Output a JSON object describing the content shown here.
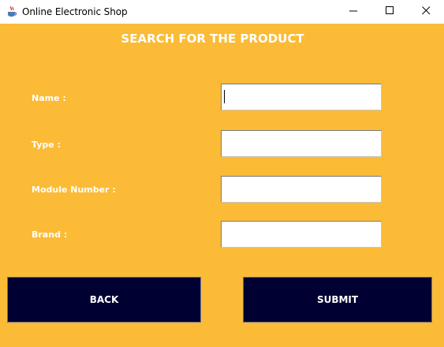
{
  "window": {
    "title": "Online Electronic Shop",
    "icons": {
      "app": "java-cup-icon",
      "minimize": "minimize-icon",
      "maximize": "maximize-icon",
      "close": "close-icon"
    }
  },
  "form": {
    "heading": "SEARCH FOR THE PRODUCT",
    "fields": [
      {
        "label": "Name :",
        "value": ""
      },
      {
        "label": "Type :",
        "value": ""
      },
      {
        "label": "Module Number :",
        "value": ""
      },
      {
        "label": "Brand :",
        "value": ""
      }
    ],
    "back_label": "BACK",
    "submit_label": "SUBMIT"
  },
  "colors": {
    "background": "#fbbb36",
    "button": "#000033",
    "text_light": "#ffffff"
  }
}
